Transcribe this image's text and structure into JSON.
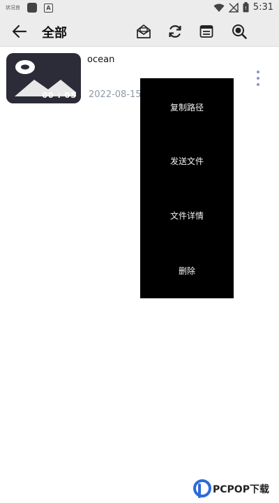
{
  "status_bar": {
    "carrier": "状况良",
    "time": "5:31",
    "icons": [
      "app-icon",
      "a-icon",
      "wifi-icon",
      "signal-off-icon",
      "battery-icon"
    ]
  },
  "app_bar": {
    "title": "全部",
    "icons": [
      "back-arrow-icon",
      "mail-icon",
      "refresh-icon",
      "list-icon",
      "search-icon"
    ]
  },
  "files": [
    {
      "name": "ocean",
      "date": "2022-08-15",
      "duration": "00 : 05",
      "thumbnail_icon": "image-placeholder-icon"
    }
  ],
  "context_menu": {
    "items": [
      {
        "label": "复制路径"
      },
      {
        "label": "发送文件"
      },
      {
        "label": "文件详情"
      },
      {
        "label": "删除"
      }
    ]
  },
  "watermark": {
    "text": "PCPOP下载",
    "brand_color": "#2d6bd8"
  },
  "colors": {
    "bar_background": "#ececec",
    "menu_background": "#000000",
    "date_text": "#8f9aa8",
    "more_dots": "#8a93c8"
  }
}
